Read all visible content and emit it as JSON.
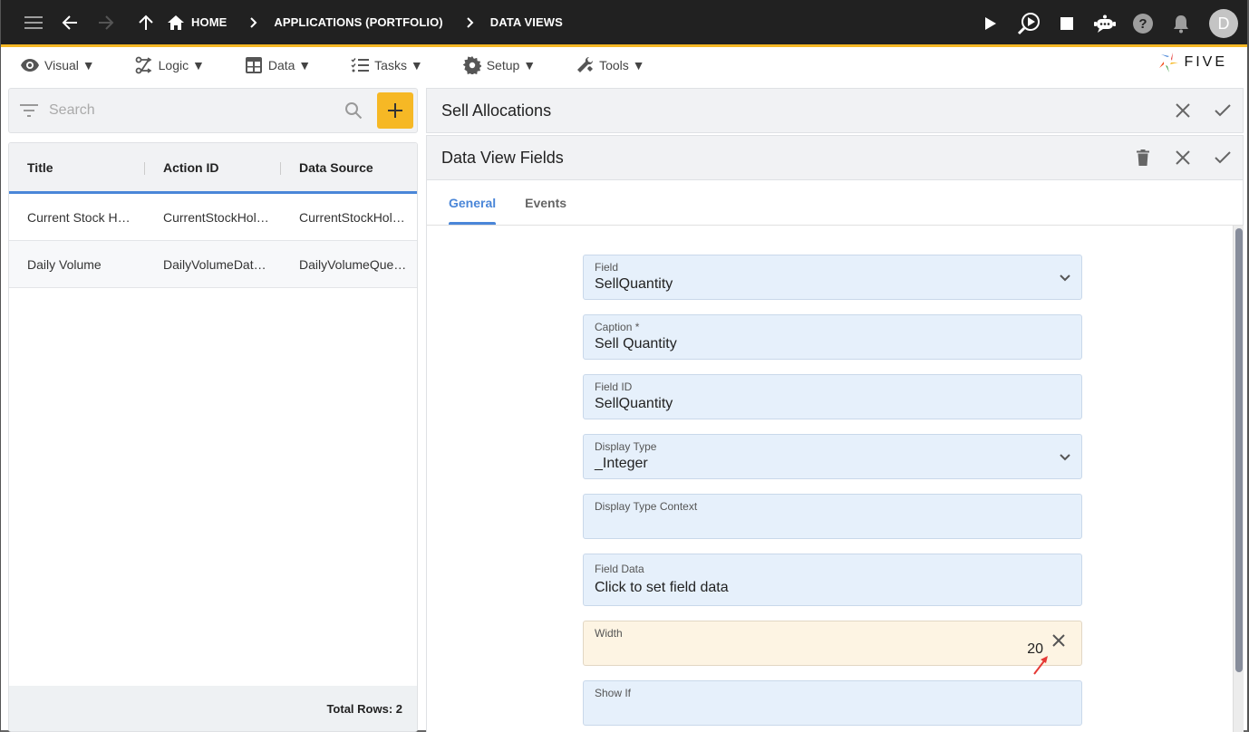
{
  "topbar": {
    "breadcrumbs": [
      "HOME",
      "APPLICATIONS (PORTFOLIO)",
      "DATA VIEWS"
    ],
    "avatar_initial": "D",
    "accent_color": "#f6b825"
  },
  "menubar": {
    "items": [
      {
        "label": "Visual ▼",
        "icon": "eye-icon"
      },
      {
        "label": "Logic ▼",
        "icon": "logic-flow-icon"
      },
      {
        "label": "Data ▼",
        "icon": "table-icon"
      },
      {
        "label": "Tasks ▼",
        "icon": "checklist-icon"
      },
      {
        "label": "Setup ▼",
        "icon": "gear-icon"
      },
      {
        "label": "Tools ▼",
        "icon": "tools-icon"
      }
    ],
    "logo_text": "FIVE"
  },
  "left_panel": {
    "search_placeholder": "Search",
    "columns": [
      "Title",
      "Action ID",
      "Data Source"
    ],
    "rows": [
      [
        "Current Stock Holdings",
        "CurrentStockHoldings",
        "CurrentStockHoldings"
      ],
      [
        "Daily Volume",
        "DailyVolumeDataView",
        "DailyVolumeQuery"
      ]
    ],
    "rows_display": [
      [
        "Current Stock Ho…",
        "CurrentStockHol…",
        "CurrentStockHol…"
      ],
      [
        "Daily Volume",
        "DailyVolumeData…",
        "DailyVolumeQuer…"
      ]
    ],
    "footer": "Total Rows: 2"
  },
  "right_panel": {
    "parent_title": "Sell Allocations",
    "child_title": "Data View Fields",
    "tabs": [
      {
        "label": "General",
        "active": true
      },
      {
        "label": "Events",
        "active": false
      }
    ],
    "fields": [
      {
        "label": "Field",
        "value": "SellQuantity",
        "type": "select"
      },
      {
        "label": "Caption *",
        "value": "Sell Quantity",
        "type": "text"
      },
      {
        "label": "Field ID",
        "value": "SellQuantity",
        "type": "text"
      },
      {
        "label": "Display Type",
        "value": "_Integer",
        "type": "select"
      },
      {
        "label": "Display Type Context",
        "value": "",
        "type": "text"
      },
      {
        "label": "Field Data",
        "value": "Click to set field data",
        "type": "button"
      },
      {
        "label": "Width",
        "value": "20",
        "type": "number"
      },
      {
        "label": "Show If",
        "value": "",
        "type": "text"
      }
    ]
  }
}
